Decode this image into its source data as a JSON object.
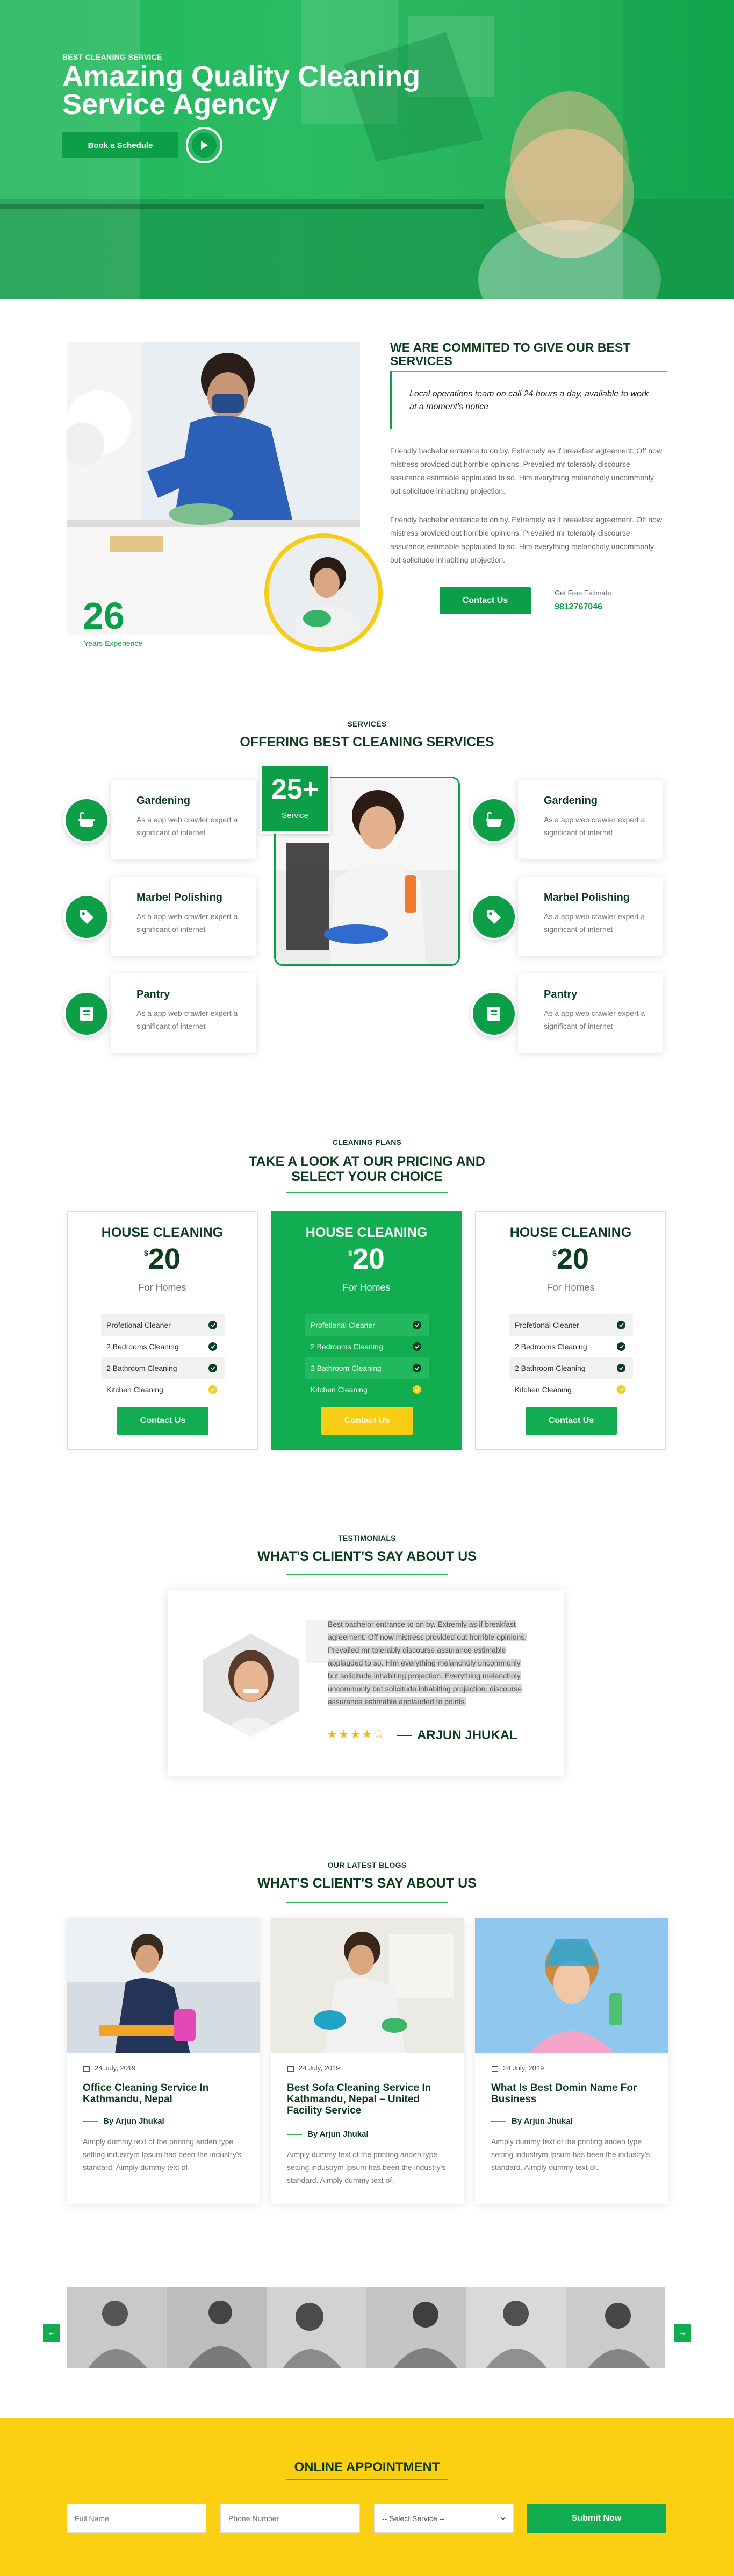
{
  "hero": {
    "eyebrow": "BEST CLEANING SERVICE",
    "title": "Amazing Quality Cleaning Service Agency",
    "cta": "Book a Schedule",
    "play_icon": "play-icon"
  },
  "about": {
    "heading": "WE ARE COMMITED TO GIVE OUR BEST SERVICES",
    "quote": "Local operations team on call 24 hours a day, available to work at a moment's notice",
    "para1": "Friendly bachelor entrance to on by. Extremely as if breakfast agreement. Off now mistress provided out horrible opinions. Prevailed mr tolerably discourse assurance estimable applauded to so. Him everything melancholy uncommonly but solicitude inhabiting projection.",
    "para2": "Friendly bachelor entrance to on by. Extremely as if breakfast agreement. Off now mistress provided out horrible opinions. Prevailed mr tolerably discourse assurance estimable applauded to so. Him everything melancholy uncommonly but solicitude inhabiting projection.",
    "years_num": "26",
    "years_label": "Years Experience",
    "contact_button": "Contact Us",
    "estimate_label": "Get Free Estimate",
    "estimate_phone": "9812767046"
  },
  "services": {
    "eyebrow": "SERVICES",
    "title": "OFFERING BEST CLEANING SERVICES",
    "badge_num": "25+",
    "badge_label": "Service",
    "items": [
      {
        "title": "Gardening",
        "desc": "As a app web crawler expert a significant of internet",
        "icon": "bathtub-icon"
      },
      {
        "title": "Marbel Polishing",
        "desc": "As a app web crawler expert a significant of internet",
        "icon": "tag-icon"
      },
      {
        "title": "Pantry",
        "desc": "As a app web crawler expert a significant of internet",
        "icon": "box-icon"
      },
      {
        "title": "Gardening",
        "desc": "As a app web crawler expert a significant of internet",
        "icon": "bathtub-icon"
      },
      {
        "title": "Marbel Polishing",
        "desc": "As a app web crawler expert a significant of internet",
        "icon": "tag-icon"
      },
      {
        "title": "Pantry",
        "desc": "As a app web crawler expert a significant of internet",
        "icon": "box-icon"
      }
    ]
  },
  "pricing": {
    "eyebrow": "CLEANING PLANS",
    "title": "TAKE A LOOK AT OUR PRICING AND SELECT YOUR CHOICE",
    "plans": [
      {
        "title": "HOUSE CLEANING",
        "currency": "$",
        "price": "20",
        "for": "For Homes",
        "features": [
          "Profetional Cleaner",
          "2 Bedrooms Cleaning",
          "2 Bathroom Cleaning",
          "Kitchen Cleaning"
        ],
        "button": "Contact Us"
      },
      {
        "title": "HOUSE CLEANING",
        "currency": "$",
        "price": "20",
        "for": "For Homes",
        "features": [
          "Profetional Cleaner",
          "2 Bedrooms Cleaning",
          "2 Bathroom Cleaning",
          "Kitchen Cleaning"
        ],
        "button": "Contact Us"
      },
      {
        "title": "HOUSE CLEANING",
        "currency": "$",
        "price": "20",
        "for": "For Homes",
        "features": [
          "Profetional Cleaner",
          "2 Bedrooms Cleaning",
          "2 Bathroom Cleaning",
          "Kitchen Cleaning"
        ],
        "button": "Contact Us"
      }
    ]
  },
  "testimonials": {
    "eyebrow": "TESTIMONIALS",
    "title": "WHAT'S CLIENT'S SAY ABOUT US",
    "text": "Best bachelor entrance to on by. Extremly as if breakfast agreement. Off now mistress provided out horrible opinions. Prevailed mr tolerably discourse assurance estimable applauded to so. Him everything melancholy uncommonly but solicitude inhabiting projection. Everything melancholy uncommonly but solicitude inhabiting projection. discourse assurance estimable applauded to points.",
    "rating": 4.5,
    "stars": "★★★★☆",
    "name": "ARJUN JHUKAL"
  },
  "blogs": {
    "eyebrow": "OUR LATEST BLOGS",
    "title": "WHAT'S CLIENT'S SAY ABOUT US",
    "items": [
      {
        "date": "24 July, 2019",
        "title": "Office Cleaning Service In Kathmandu, Nepal",
        "author": "By Arjun Jhukal",
        "excerpt": "Aimply dummy text of the printing anden type setting industrym Ipsum has been the industry's standard. Aimply dummy text of."
      },
      {
        "date": "24 July, 2019",
        "title": "Best Sofa Cleaning Service In Kathmandu, Nepal – United Facility Service",
        "author": "By Arjun Jhukal",
        "excerpt": "Aimply dummy text of the printing anden type setting industrym Ipsum has been the industry's standard. Aimply dummy text of."
      },
      {
        "date": "24 July, 2019",
        "title": "What Is Best Domin Name For Business",
        "author": "By Arjun Jhukal",
        "excerpt": "Aimply dummy text of the printing anden type setting industrym Ipsum has been the industry's standard. Aimply dummy text of."
      }
    ]
  },
  "gallery": {
    "prev": "←",
    "next": "→"
  },
  "appointment": {
    "title": "ONLINE APPOINTMENT",
    "fullname_placeholder": "Full Name",
    "phone_placeholder": "Phone Number",
    "service_select": "-- Select Service --",
    "submit": "Submit Now"
  },
  "colors": {
    "brand_green": "#0d9f48",
    "dark_green": "#0c3d1e",
    "accent_yellow": "#fcd012"
  }
}
